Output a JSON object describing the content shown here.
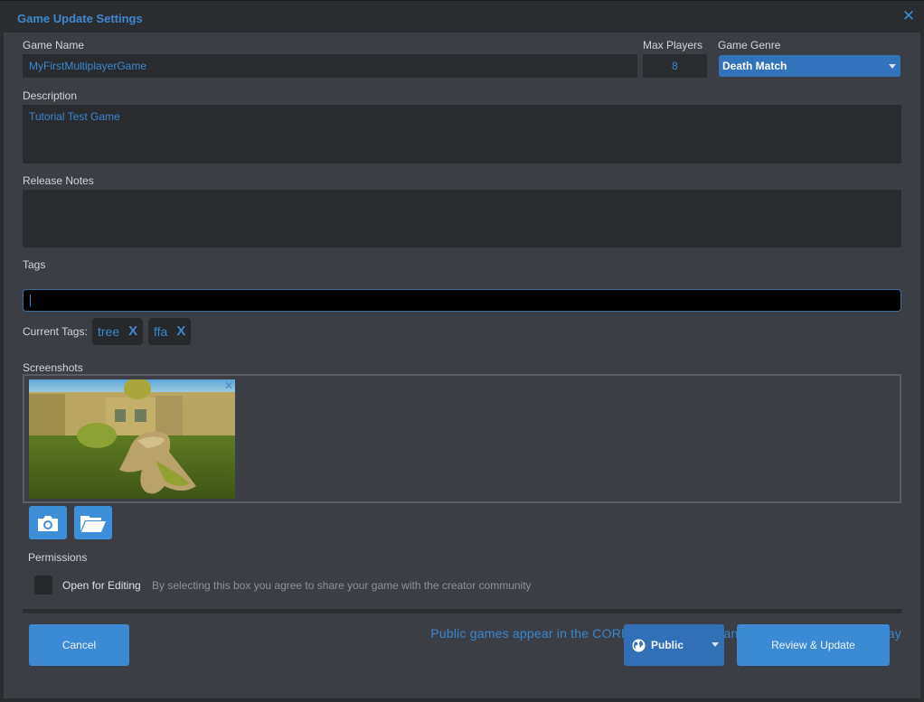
{
  "window": {
    "title": "Game Update Settings",
    "close_icon": "close-icon"
  },
  "form": {
    "game_name": {
      "label": "Game Name",
      "value": "MyFirstMultiplayerGame"
    },
    "max_players": {
      "label": "Max Players",
      "value": "8"
    },
    "game_genre": {
      "label": "Game Genre",
      "selected": "Death Match"
    },
    "description": {
      "label": "Description",
      "value": "Tutorial Test Game"
    },
    "release_notes": {
      "label": "Release Notes",
      "value": ""
    },
    "tags": {
      "label": "Tags",
      "input_value": "",
      "current_label": "Current Tags:",
      "current": [
        {
          "label": "tree",
          "remove": "X"
        },
        {
          "label": "ffa",
          "remove": "X"
        }
      ]
    },
    "screenshots": {
      "label": "Screenshots",
      "items": [
        {
          "alt": "Game screenshot: mossy tree stump in ruins",
          "remove": "✕"
        }
      ],
      "take_screenshot_icon": "camera-icon",
      "browse_icon": "folder-icon"
    },
    "permissions": {
      "label": "Permissions",
      "open_for_editing": {
        "label": "Open for Editing",
        "checked": false,
        "hint": "By selecting this box you agree to share your game with the creator community"
      }
    }
  },
  "footer": {
    "public_note": "Public games appear in the CORE Game Browser and are available for all to play",
    "cancel_label": "Cancel",
    "visibility": {
      "selected": "Public",
      "icon": "globe-icon"
    },
    "submit_label": "Review & Update"
  },
  "colors": {
    "accent": "#3c88cf",
    "button": "#3c8ad4",
    "dropdown": "#3373bb",
    "panel": "#3b3e45",
    "field": "#2a2b2e"
  }
}
